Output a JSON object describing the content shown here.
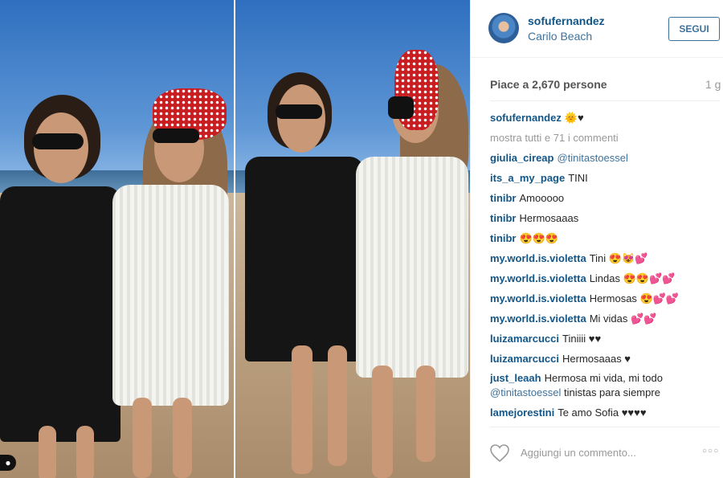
{
  "post": {
    "username": "sofufernandez",
    "location": "Carilo Beach",
    "follow_label": "SEGUI",
    "likes": "Piace a 2,670 persone",
    "time_ago": "1 g",
    "caption_user": "sofufernandez",
    "caption_text": "🌞♥",
    "show_all": "mostra tutti e 71 i commenti",
    "add_comment_placeholder": "Aggiungi un commento...",
    "more_icon": "○○○"
  },
  "comments": [
    {
      "user": "giulia_cireap",
      "text": "@tinitastoessel"
    },
    {
      "user": "its_a_my_page",
      "text": "TINI"
    },
    {
      "user": "tinibr",
      "text": "Amooooo"
    },
    {
      "user": "tinibr",
      "text": "Hermosaaas"
    },
    {
      "user": "tinibr",
      "text": "😍😍😍"
    },
    {
      "user": "my.world.is.violetta",
      "text": "Tini 😍😻💕"
    },
    {
      "user": "my.world.is.violetta",
      "text": "Lindas 😍😍💕💕"
    },
    {
      "user": "my.world.is.violetta",
      "text": "Hermosas 😍💕💕"
    },
    {
      "user": "my.world.is.violetta",
      "text": "Mi vidas 💕💕"
    },
    {
      "user": "luizamarcucci",
      "text": "Tiniiii ♥♥"
    },
    {
      "user": "luizamarcucci",
      "text": "Hermosaaas ♥"
    },
    {
      "user": "just_leaah",
      "text": "Hermosa mi vida, mi todo",
      "tag": "@tinitastoessel",
      "text2": "tinistas para siempre"
    },
    {
      "user": "lamejorestini",
      "text": "Te amo Sofia ♥♥♥♥"
    }
  ],
  "icons": {
    "heart": "heart-outline-icon",
    "options": "more-options-icon",
    "user_tag": "user-tag-icon"
  },
  "colors": {
    "username_blue": "#125688",
    "link_blue": "#3f729b",
    "muted": "#999999"
  }
}
